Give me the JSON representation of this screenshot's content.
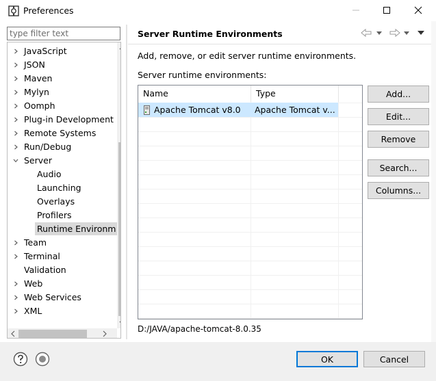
{
  "window": {
    "title": "Preferences"
  },
  "filter": {
    "placeholder": "type filter text",
    "value": ""
  },
  "tree": [
    {
      "label": "JavaScript",
      "expanded": false
    },
    {
      "label": "JSON",
      "expanded": false
    },
    {
      "label": "Maven",
      "expanded": false
    },
    {
      "label": "Mylyn",
      "expanded": false
    },
    {
      "label": "Oomph",
      "expanded": false
    },
    {
      "label": "Plug-in Development",
      "expanded": false
    },
    {
      "label": "Remote Systems",
      "expanded": false
    },
    {
      "label": "Run/Debug",
      "expanded": false
    },
    {
      "label": "Server",
      "expanded": true
    },
    {
      "label": "Audio",
      "child": true
    },
    {
      "label": "Launching",
      "child": true
    },
    {
      "label": "Overlays",
      "child": true
    },
    {
      "label": "Profilers",
      "child": true
    },
    {
      "label": "Runtime Environm",
      "child": true,
      "selected": true
    },
    {
      "label": "Team",
      "expanded": false
    },
    {
      "label": "Terminal",
      "expanded": false
    },
    {
      "label": "Validation",
      "leaf": true
    },
    {
      "label": "Web",
      "expanded": false
    },
    {
      "label": "Web Services",
      "expanded": false
    },
    {
      "label": "XML",
      "expanded": false
    }
  ],
  "page": {
    "title": "Server Runtime Environments",
    "description": "Add, remove, or edit server runtime environments.",
    "list_label": "Server runtime environments:",
    "columns": [
      "Name",
      "Type"
    ],
    "rows": [
      {
        "name": "Apache Tomcat v8.0",
        "type": "Apache Tomcat v...",
        "selected": true
      }
    ],
    "path": "D:/JAVA/apache-tomcat-8.0.35"
  },
  "buttons": {
    "add": "Add...",
    "edit": "Edit...",
    "remove": "Remove",
    "search": "Search...",
    "columns": "Columns..."
  },
  "dialog": {
    "ok": "OK",
    "cancel": "Cancel"
  },
  "colors": {
    "selection": "#cce8ff",
    "default_button_border": "#0078d7",
    "tree_selection": "#d9d9d9"
  }
}
